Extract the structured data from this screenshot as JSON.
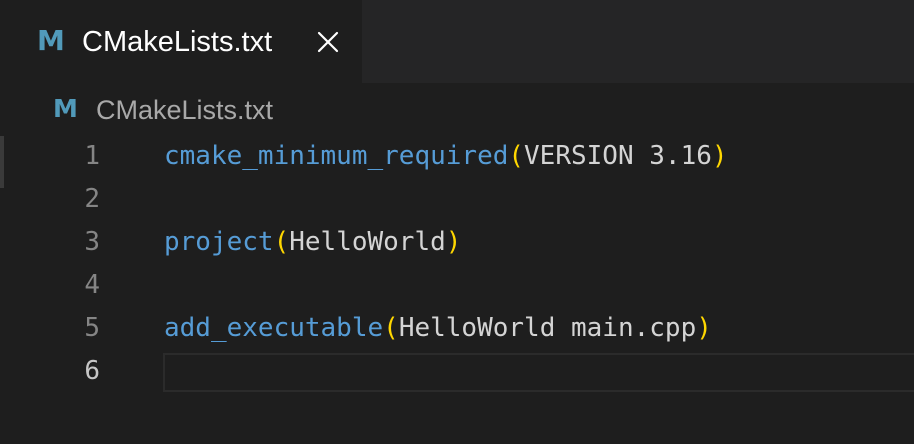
{
  "tab": {
    "icon": "cmake-m-icon",
    "icon_glyph": "M",
    "label": "CMakeLists.txt",
    "close_icon": "close-icon"
  },
  "breadcrumb": {
    "icon_glyph": "M",
    "label": "CMakeLists.txt"
  },
  "editor": {
    "active_line": 6,
    "lines": [
      {
        "number": "1",
        "tokens": [
          {
            "t": "fn",
            "v": "cmake_minimum_required"
          },
          {
            "t": "par",
            "v": "("
          },
          {
            "t": "txt",
            "v": "VERSION 3.16"
          },
          {
            "t": "par",
            "v": ")"
          }
        ]
      },
      {
        "number": "2",
        "tokens": []
      },
      {
        "number": "3",
        "tokens": [
          {
            "t": "fn",
            "v": "project"
          },
          {
            "t": "par",
            "v": "("
          },
          {
            "t": "txt",
            "v": "HelloWorld"
          },
          {
            "t": "par",
            "v": ")"
          }
        ]
      },
      {
        "number": "4",
        "tokens": []
      },
      {
        "number": "5",
        "tokens": [
          {
            "t": "fn",
            "v": "add_executable"
          },
          {
            "t": "par",
            "v": "("
          },
          {
            "t": "txt",
            "v": "HelloWorld main.cpp"
          },
          {
            "t": "par",
            "v": ")"
          }
        ]
      },
      {
        "number": "6",
        "tokens": []
      }
    ]
  },
  "colors": {
    "background": "#1e1e1e",
    "tab_bar": "#252526",
    "icon": "#519aba",
    "function": "#569cd6",
    "paren": "#ffd700",
    "text": "#d4d4d4",
    "line_number": "#858585"
  }
}
